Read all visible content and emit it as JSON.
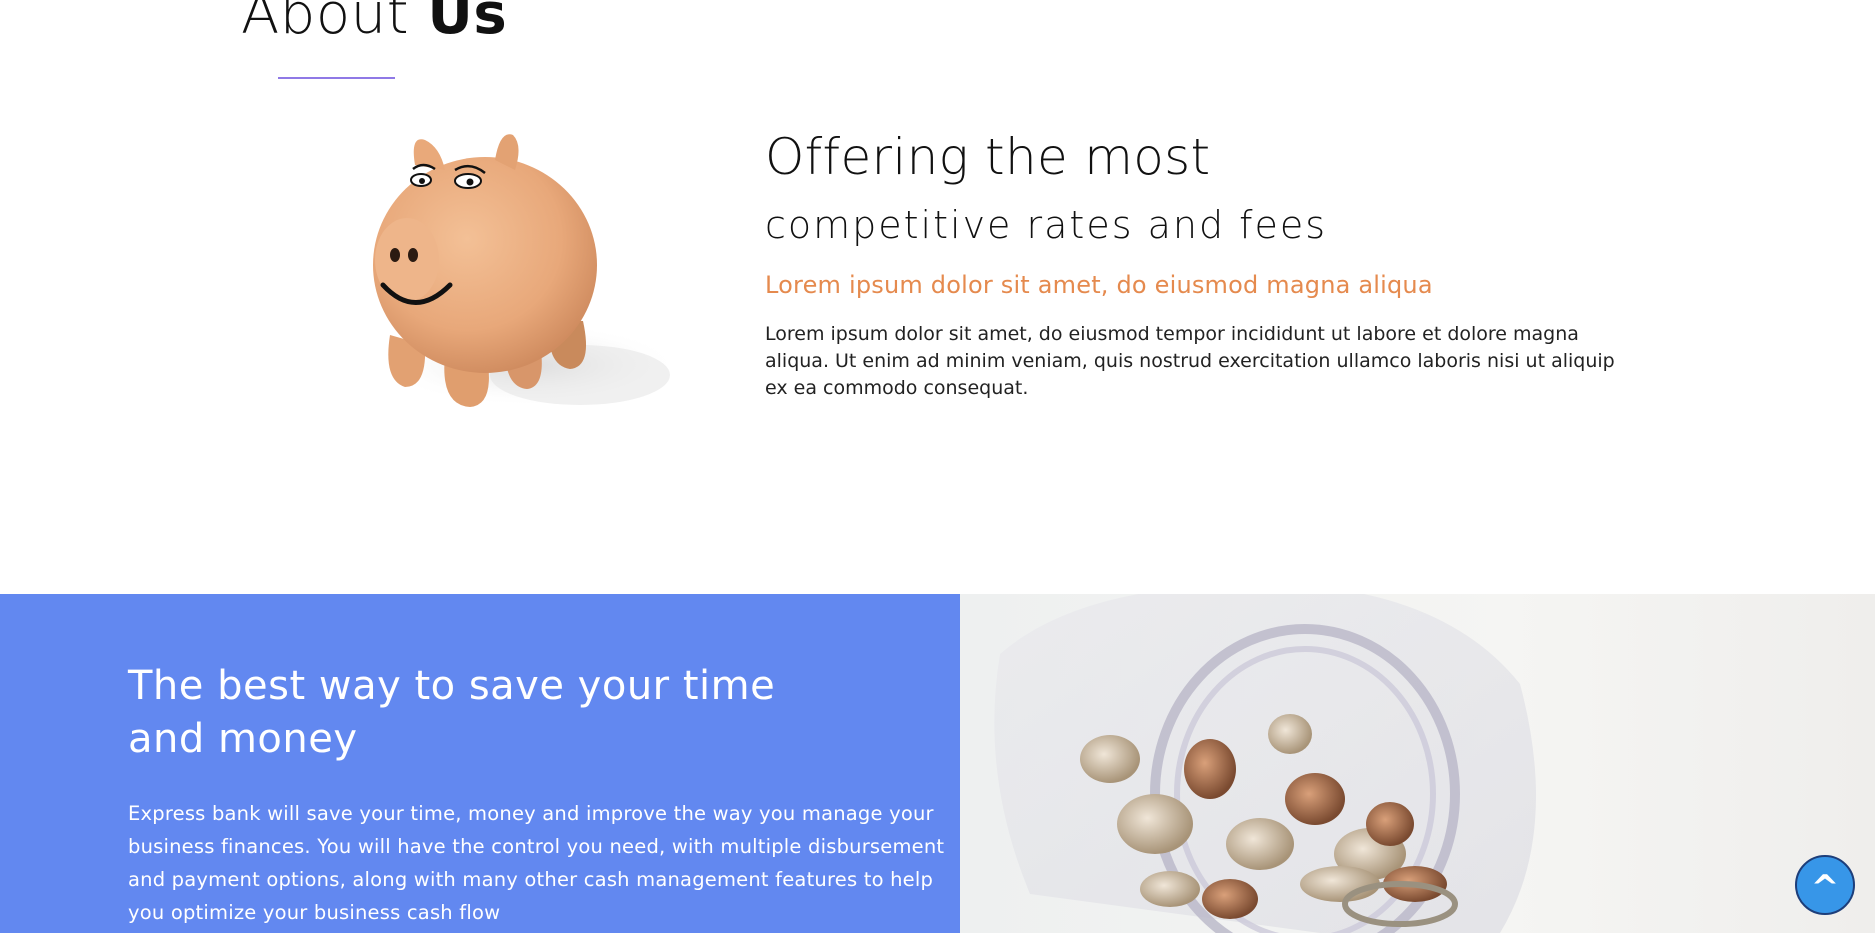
{
  "about": {
    "title_light": "About",
    "title_bold": "Us",
    "accent_color": "#8f79e6"
  },
  "offer": {
    "title": "Offering the most",
    "subtitle": "competitive rates and fees",
    "lead": "Lorem ipsum dolor sit amet, do eiusmod magna aliqua",
    "body": "Lorem ipsum dolor sit amet, do eiusmod tempor incididunt ut labore et dolore magna aliqua. Ut enim ad minim veniam, quis nostrud exercitation ullamco laboris nisi ut aliquip ex ea commodo consequat.",
    "lead_color": "#e58a4e"
  },
  "save": {
    "title": "The best way to save your time and money",
    "body": "Express bank will save your time, money and improve the way you manage your business finances. You will have the control you need, with multiple disbursement and payment options, along with many other cash management features to help you optimize your business cash flow",
    "panel_color": "#6288f0"
  },
  "images": {
    "piggy": "piggy-bank-image",
    "jar": "coin-jar-image"
  },
  "scroll_top": {
    "label": "^",
    "color": "#3796e8"
  }
}
